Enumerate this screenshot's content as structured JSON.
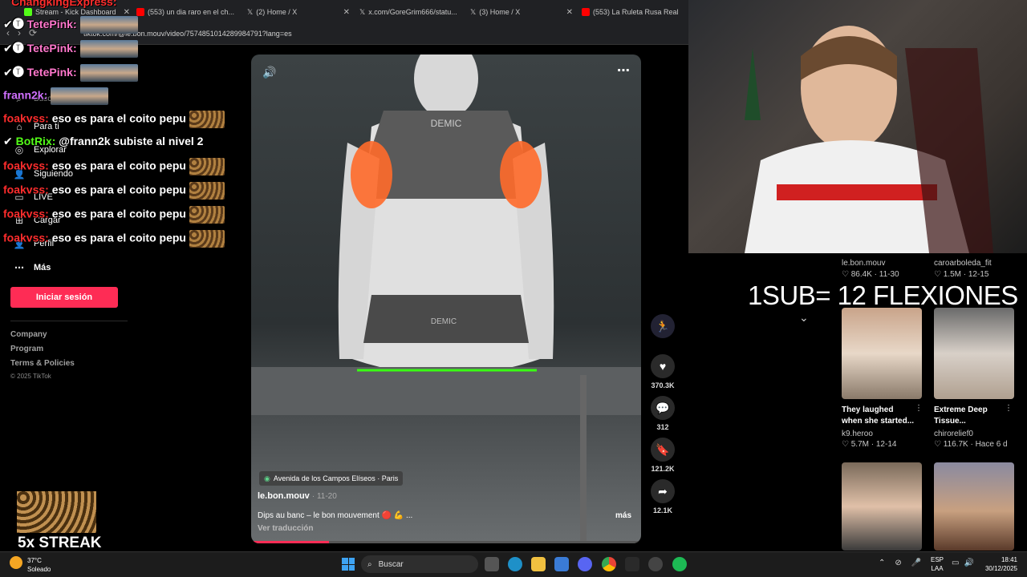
{
  "browser": {
    "tabs": [
      {
        "label": "Stream - Kick Dashboard"
      },
      {
        "label": "(553) un dia raro en el ch..."
      },
      {
        "label": "(2) Home / X"
      },
      {
        "label": "x.com/GoreGrim666/statu..."
      },
      {
        "label": "(3) Home / X"
      },
      {
        "label": "(553) La Ruleta Rusa Real"
      }
    ],
    "url": "tiktok.com/@le.bon.mouv/video/7574851014289984791?lang=es"
  },
  "tiktok": {
    "search_placeholder": "Buscar",
    "nav": [
      {
        "label": "Para ti"
      },
      {
        "label": "Explorar"
      },
      {
        "label": "Siguiendo"
      },
      {
        "label": "LIVE"
      },
      {
        "label": "Cargar"
      },
      {
        "label": "Perfil"
      },
      {
        "label": "Más"
      }
    ],
    "signin_label": "Iniciar sesión",
    "footer": [
      "Company",
      "Program",
      "Terms & Policies",
      "© 2025 TikTok"
    ],
    "video": {
      "location": "Avenida de los Campos Elíseos · Paris",
      "author": "le.bon.mouv",
      "date": "· 11-20",
      "caption": "Dips au banc – le bon mouvement 🔴 💪 ...",
      "more": "más",
      "translate": "Ver traducción",
      "shirt_text_top": "DEMIC",
      "shirt_text_bottom": "DEMIC",
      "progress": 0.2
    },
    "actions": {
      "likes": "370.3K",
      "comments": "312",
      "saves": "121.2K",
      "shares": "12.1K"
    },
    "recommended": [
      {
        "author": "le.bon.mouv",
        "stats": "♡ 86.4K · 11-30"
      },
      {
        "author": "caroarboleda_fit",
        "stats": "♡ 1.5M · 12-15"
      },
      {
        "caption1": "They laughed",
        "caption2": "when she started...",
        "author": "k9.heroo",
        "stats": "♡ 5.7M · 12-14"
      },
      {
        "caption1": "Extreme Deep",
        "caption2": "Tissue...",
        "author": "chirorelief0",
        "stats": "♡ 116.7K · Hace 6 d"
      }
    ]
  },
  "chat": [
    {
      "user": "ChangkingExpress:",
      "msg": ""
    },
    {
      "user": "TetePink:",
      "msg": ""
    },
    {
      "user": "TetePink:",
      "msg": ""
    },
    {
      "user": "TetePink:",
      "msg": ""
    },
    {
      "user": "frann2k:",
      "msg": ""
    },
    {
      "user": "foakvss:",
      "msg": " eso es para el coito pepu"
    },
    {
      "user": "BotRix:",
      "msg": " @frann2k subiste al nivel 2"
    },
    {
      "user": "foakvss:",
      "msg": " eso es para el coito pepu"
    },
    {
      "user": "foakvss:",
      "msg": " eso es para el coito pepu"
    },
    {
      "user": "foakvss:",
      "msg": " eso es para el coito pepu"
    },
    {
      "user": "foakvss:",
      "msg": " eso es para el coito pepu"
    }
  ],
  "stream": {
    "overlay": "1SUB= 12 FLEXIONES",
    "streak": "5x STREAK"
  },
  "taskbar": {
    "weather_temp": "37°C",
    "weather_desc": "Soleado",
    "search": "Buscar",
    "lang1": "ESP",
    "lang2": "LAA",
    "time": "18:41",
    "date": "30/12/2025"
  }
}
